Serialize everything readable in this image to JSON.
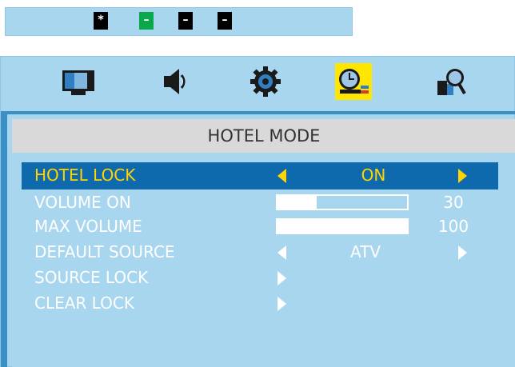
{
  "key_strip": {
    "keys": [
      {
        "label": "*",
        "color": "#000000"
      },
      {
        "label": "–",
        "color": "#0aa84a"
      },
      {
        "label": "–",
        "color": "#000000"
      },
      {
        "label": "–",
        "color": "#000000"
      }
    ]
  },
  "tabs": [
    {
      "name": "picture",
      "icon": "monitor-icon",
      "active": false
    },
    {
      "name": "sound",
      "icon": "speaker-icon",
      "active": false
    },
    {
      "name": "setup",
      "icon": "gear-icon",
      "active": false
    },
    {
      "name": "time",
      "icon": "clock-icon",
      "active": true
    },
    {
      "name": "lock",
      "icon": "magnifier-lock-icon",
      "active": false
    }
  ],
  "panel": {
    "title": "HOTEL MODE",
    "rows": [
      {
        "label": "HOTEL LOCK",
        "value": "ON"
      },
      {
        "label": "VOLUME ON",
        "value": "30",
        "level": 0.3
      },
      {
        "label": "MAX VOLUME",
        "value": "100",
        "level": 1.0
      },
      {
        "label": "DEFAULT SOURCE",
        "value": "ATV"
      },
      {
        "label": "SOURCE LOCK"
      },
      {
        "label": "CLEAR LOCK"
      }
    ]
  },
  "colors": {
    "background": "#a9d6ef",
    "selected_row": "#0f6aad",
    "selected_text": "#ffd400",
    "title_bar": "#d9d9d9",
    "accent_border": "#3a8fc5",
    "active_tab": "#ffe600"
  }
}
